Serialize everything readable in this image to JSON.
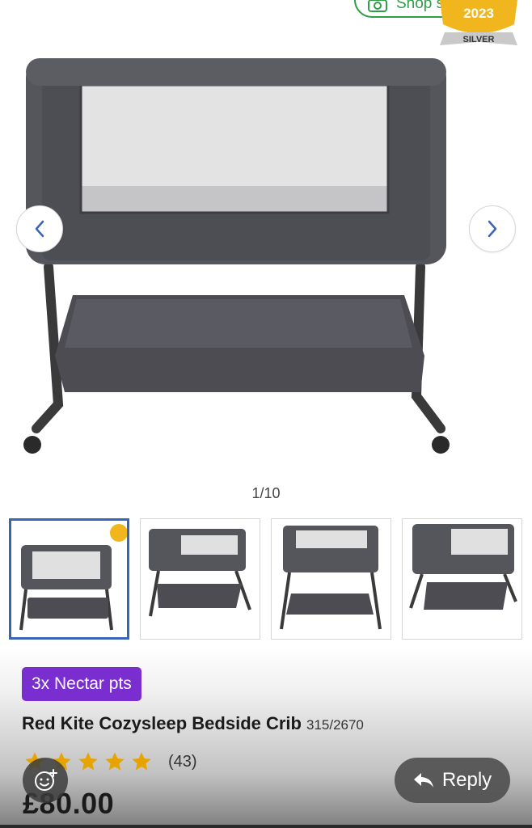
{
  "shop_similar": {
    "label": "Shop similar"
  },
  "award": {
    "year": "2023",
    "tier": "SILVER"
  },
  "gallery": {
    "counter": "1/10"
  },
  "product": {
    "offer_badge": "3x Nectar pts",
    "title": "Red Kite Cozysleep Bedside Crib",
    "code": "315/2670",
    "rating": {
      "stars": 5,
      "count_label": "(43)"
    },
    "price": "£80.00"
  },
  "reply": {
    "label": "Reply"
  },
  "colors": {
    "accent_green": "#2e9e47",
    "nectar_purple": "#7a2ed0",
    "star_gold": "#e7a400",
    "selected_blue": "#3a64b8"
  }
}
